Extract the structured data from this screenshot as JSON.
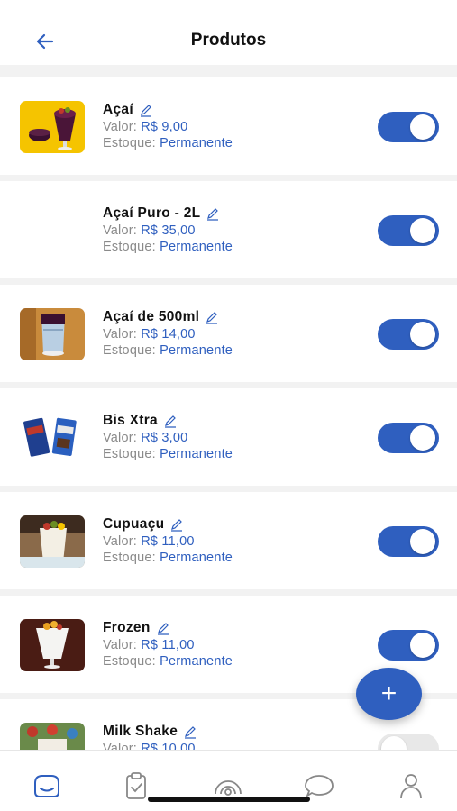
{
  "header": {
    "title": "Produtos",
    "back_icon": "arrow-left-icon"
  },
  "labels": {
    "price": "Valor: ",
    "stock": "Estoque: "
  },
  "accent_color": "#2f5fbf",
  "products": [
    {
      "name": "Açaí",
      "price": "R$ 9,00",
      "stock": "Permanente",
      "enabled": true,
      "image": "acai-cup-image"
    },
    {
      "name": "Açaí Puro - 2L",
      "price": "R$ 35,00",
      "stock": "Permanente",
      "enabled": true,
      "image": null
    },
    {
      "name": "Açaí de 500ml",
      "price": "R$ 14,00",
      "stock": "Permanente",
      "enabled": true,
      "image": "acai-500ml-image"
    },
    {
      "name": "Bis Xtra",
      "price": "R$ 3,00",
      "stock": "Permanente",
      "enabled": true,
      "image": "bis-xtra-image"
    },
    {
      "name": "Cupuaçu",
      "price": "R$ 11,00",
      "stock": "Permanente",
      "enabled": true,
      "image": "cupuacu-image"
    },
    {
      "name": "Frozen",
      "price": "R$ 11,00",
      "stock": "Permanente",
      "enabled": true,
      "image": "frozen-image"
    },
    {
      "name": "Milk Shake",
      "price": "R$ 10,00",
      "stock": "",
      "enabled": false,
      "image": "milk-shake-image"
    }
  ],
  "fab": {
    "label": "+"
  },
  "tabbar": {
    "items": [
      "home-icon",
      "orders-icon",
      "broadcast-icon",
      "chat-icon",
      "profile-icon"
    ]
  }
}
